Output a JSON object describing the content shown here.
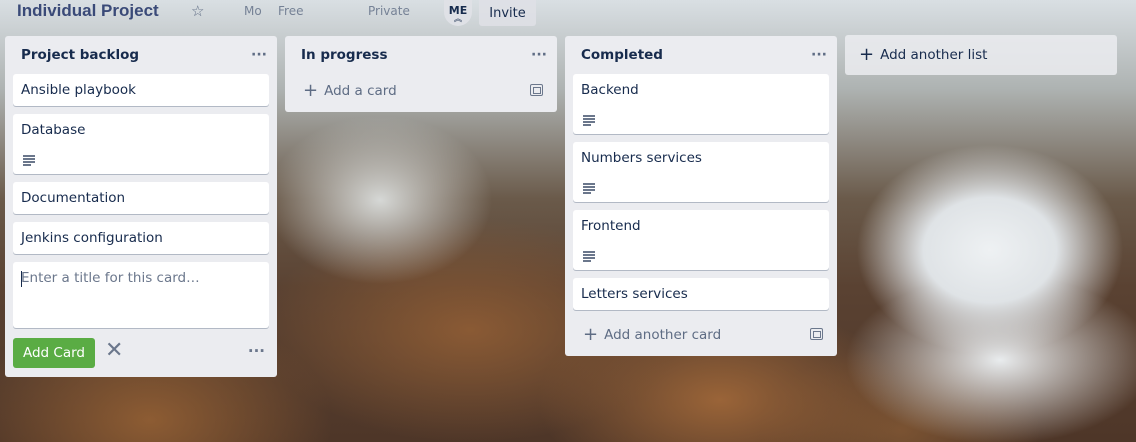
{
  "header": {
    "board_title": "Individual Project",
    "workspace_short": "Mo",
    "plan": "Free",
    "visibility": "Private",
    "avatar_initials": "ME",
    "invite_label": "Invite"
  },
  "lists": [
    {
      "title": "Project backlog",
      "cards": [
        "Ansible playbook",
        "Database",
        "Documentation",
        "Jenkins configuration"
      ],
      "composer_placeholder": "Enter a title for this card…",
      "add_card_button": "Add Card"
    },
    {
      "title": "In progress",
      "add_label": "Add a card"
    },
    {
      "title": "Completed",
      "cards": [
        "Backend",
        "Numbers services",
        "Frontend",
        "Letters services"
      ],
      "add_label": "Add another card"
    }
  ],
  "add_list_label": "Add another list",
  "icons": {
    "star": "star-icon",
    "menu": "more-dots-icon",
    "description": "description-icon",
    "template": "card-template-icon",
    "close": "close-icon",
    "plus": "plus-icon"
  },
  "colors": {
    "list_bg": "#ebecf0",
    "add_button": "#5aac44",
    "title": "#3a4a78"
  }
}
